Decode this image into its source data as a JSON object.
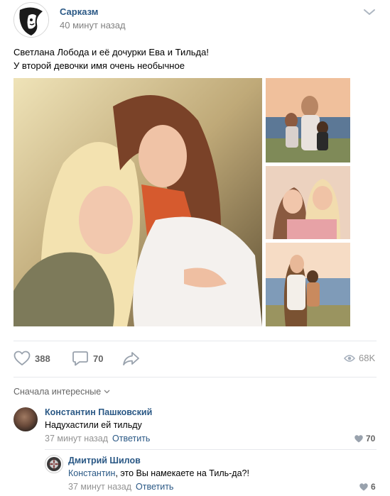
{
  "post": {
    "author": "Сарказм",
    "time": "40 минут назад",
    "text_line1": "Светлана Лобода и её дочурки Ева и Тильда!",
    "text_line2": "У второй девочки имя очень необычное"
  },
  "actions": {
    "likes": "388",
    "comments": "70",
    "views": "68K"
  },
  "comments_sort": "Сначала интересные",
  "comments": [
    {
      "author": "Константин Пашковский",
      "text": "Надухастили ей тильду",
      "time": "37 минут назад",
      "reply_label": "Ответить",
      "likes": "70"
    },
    {
      "author": "Дмитрий Шилов",
      "reply_to": "Константин",
      "text": ", это Вы намекаете на Тиль-да?!",
      "time": "37 минут назад",
      "reply_label": "Ответить",
      "likes": "6"
    }
  ],
  "colors": {
    "link": "#2a5885",
    "muted": "#939393",
    "icon": "#99a2ad"
  },
  "icons": [
    "menu-chevron-icon",
    "heart-icon",
    "comment-icon",
    "share-icon",
    "eye-icon",
    "chevron-down-icon"
  ]
}
